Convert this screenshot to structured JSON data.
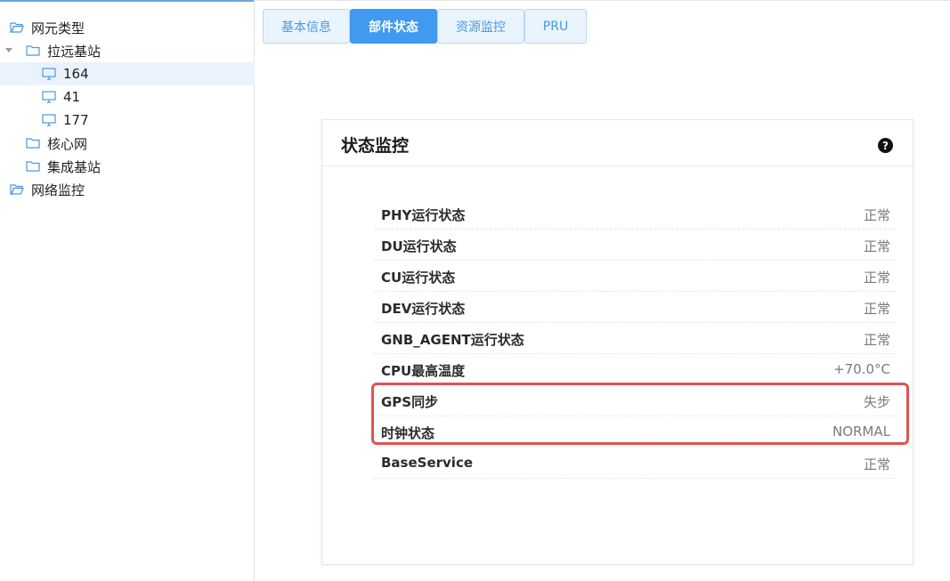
{
  "sidebar": {
    "items": [
      {
        "label": "网元类型",
        "icon": "folder-open-icon"
      },
      {
        "label": "拉远基站",
        "icon": "folder-icon"
      },
      {
        "label": "164",
        "icon": "monitor-icon"
      },
      {
        "label": "41",
        "icon": "monitor-icon"
      },
      {
        "label": "177",
        "icon": "monitor-icon"
      },
      {
        "label": "核心网",
        "icon": "folder-icon"
      },
      {
        "label": "集成基站",
        "icon": "folder-icon"
      },
      {
        "label": "网络监控",
        "icon": "folder-open-icon"
      }
    ],
    "selected": "164"
  },
  "tabs": [
    {
      "label": "基本信息"
    },
    {
      "label": "部件状态"
    },
    {
      "label": "资源监控"
    },
    {
      "label": "PRU"
    }
  ],
  "active_tab": "部件状态",
  "panel": {
    "title": "状态监控",
    "help_icon": "question-circle-icon",
    "rows": [
      {
        "label": "PHY运行状态",
        "value": "正常"
      },
      {
        "label": "DU运行状态",
        "value": "正常"
      },
      {
        "label": "CU运行状态",
        "value": "正常"
      },
      {
        "label": "DEV运行状态",
        "value": "正常"
      },
      {
        "label": "GNB_AGENT运行状态",
        "value": "正常"
      },
      {
        "label": "CPU最高温度",
        "value": "+70.0°C"
      },
      {
        "label": "GPS同步",
        "value": "失步"
      },
      {
        "label": "时钟状态",
        "value": "NORMAL"
      },
      {
        "label": "BaseService",
        "value": "正常"
      }
    ]
  },
  "colors": {
    "accent": "#3f9af0",
    "tab_bg": "#eaf4fd",
    "selected_row": "#eaf3fd",
    "highlight": "#e05252"
  }
}
